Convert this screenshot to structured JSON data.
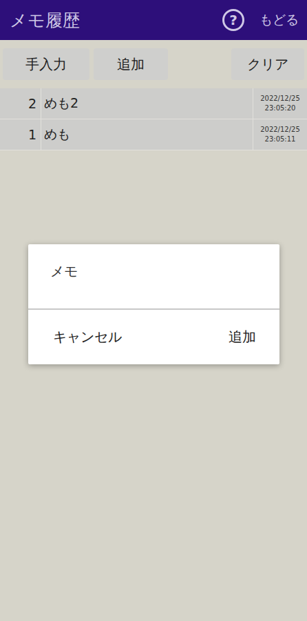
{
  "header": {
    "title": "メモ履歴",
    "help": "?",
    "back": "もどる"
  },
  "toolbar": [
    {
      "label": "手入力"
    },
    {
      "label": "追加"
    },
    {
      "label": "クリア"
    }
  ],
  "rows": [
    {
      "number": "2",
      "text": "めも2",
      "date": "2022/12/25",
      "time": "23:05:20"
    },
    {
      "number": "1",
      "text": "めも",
      "date": "2022/12/25",
      "time": "23:05:11"
    }
  ],
  "dialog": {
    "placeholder": "メモ",
    "buttons": [
      "キャンセル",
      "追加"
    ]
  }
}
